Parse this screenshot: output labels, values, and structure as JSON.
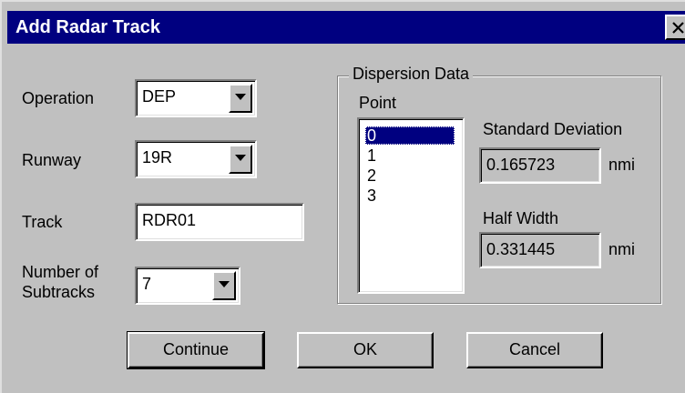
{
  "window": {
    "title": "Add Radar Track"
  },
  "form": {
    "operation": {
      "label": "Operation",
      "value": "DEP"
    },
    "runway": {
      "label": "Runway",
      "value": "19R"
    },
    "track": {
      "label": "Track",
      "value": "RDR01"
    },
    "subtracks": {
      "label_line1": "Number of",
      "label_line2": "Subtracks",
      "value": "7"
    }
  },
  "dispersion": {
    "group_title": "Dispersion Data",
    "point_label": "Point",
    "points": [
      "0",
      "1",
      "2",
      "3"
    ],
    "selected_point": "0",
    "std_dev": {
      "label": "Standard Deviation",
      "value": "0.165723",
      "unit": "nmi"
    },
    "half_width": {
      "label": "Half Width",
      "value": "0.331445",
      "unit": "nmi"
    }
  },
  "buttons": {
    "continue": "Continue",
    "ok": "OK",
    "cancel": "Cancel"
  },
  "colors": {
    "titlebar": "#000080",
    "face": "#c0c0c0",
    "selection": "#000080"
  },
  "icons": {
    "close": "close-icon",
    "dropdown": "chevron-down-icon"
  }
}
